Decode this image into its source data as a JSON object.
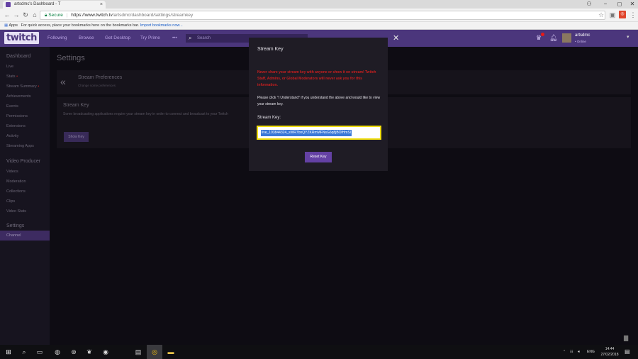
{
  "browser": {
    "tab_title": "artsdmc's Dashboard - T",
    "tab_close": "×",
    "window_controls": [
      "−",
      "◻",
      "✕"
    ],
    "secure_label": "Secure",
    "url_host": "https://www.twitch.tv",
    "url_path": "/artsdmc/dashboard/settings/streamkey",
    "bookmarks_apps": "Apps",
    "bookmarks_text": "For quick access, place your bookmarks here on the bookmarks bar.",
    "bookmarks_link": "Import bookmarks now..."
  },
  "twitch_nav": {
    "logo": "twitch",
    "links": [
      "Following",
      "Browse",
      "Get Desktop",
      "Try Prime",
      "•••"
    ],
    "search_placeholder": "Search",
    "username": "artsdmc",
    "status": "• Online"
  },
  "sidebar": {
    "dashboard_header": "Dashboard",
    "dashboard_items": [
      "Live",
      "Stats",
      "Stream Summary",
      "Achievements",
      "Events",
      "Permissions",
      "Extensions",
      "Activity",
      "Streaming Apps"
    ],
    "video_header": "Video Producer",
    "video_items": [
      "Videos",
      "Moderation",
      "Collections",
      "Clips",
      "Video Stats"
    ],
    "settings_header": "Settings",
    "settings_items": [
      "Channel"
    ]
  },
  "content": {
    "title": "Settings",
    "prefs_title": "Stream Preferences",
    "prefs_sub": "Change some preferences",
    "streamkey_title": "Stream Key",
    "streamkey_desc": "Some broadcasting applications require your stream key in order to connect and broadcast to your Twitch",
    "show_key_label": "Show Key"
  },
  "modal": {
    "title": "Stream Key",
    "warning": "Never share your stream key with anyone or show it on stream! Twitch Staff, Admins, or Global Moderators will never ask you for this information.",
    "instructions": "Please click \"I Understand\" if you understand the above and would like to view your stream key.",
    "key_label": "Stream Key:",
    "key_value": "live_193844324_sWR7bnQYZKRmMFNsG6q8jBOlHmSl",
    "reset_label": "Reset Key",
    "close": "✕"
  },
  "taskbar": {
    "lang": "ENG",
    "time": "14:44",
    "date": "27/02/2018"
  },
  "colors": {
    "twitch_purple": "#6441a4",
    "nav_purple": "#4b367c",
    "warning_red": "#c81f1f",
    "highlight_yellow": "#f0de10"
  }
}
